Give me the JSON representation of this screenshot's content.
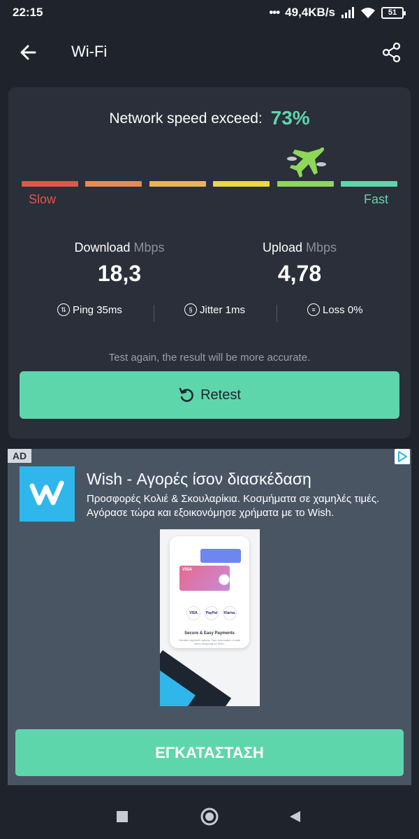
{
  "status_bar": {
    "time": "22:15",
    "net_speed": "49,4KB/s",
    "battery": "51"
  },
  "app_bar": {
    "title": "Wi-Fi",
    "back_icon": "arrow-left-icon",
    "share_icon": "share-icon"
  },
  "result": {
    "exceed_label": "Network speed exceed:",
    "exceed_value": "73%",
    "scale_segment_colors": [
      "#e2554a",
      "#e98a52",
      "#ebb54f",
      "#ecd945",
      "#8fd65a",
      "#5ed6ac"
    ],
    "scale_current_segment": 5,
    "slow_label": "Slow",
    "fast_label": "Fast",
    "download": {
      "label": "Download",
      "unit": "Mbps",
      "value": "18,3"
    },
    "upload": {
      "label": "Upload",
      "unit": "Mbps",
      "value": "4,78"
    },
    "ping": "Ping 35ms",
    "jitter": "Jitter 1ms",
    "loss": "Loss 0%",
    "hint": "Test again, the result will be more accurate.",
    "retest_label": "Retest"
  },
  "ad": {
    "badge": "AD",
    "headline": "Wish - Αγορές ίσον διασκέδαση",
    "body": "Προσφορές Κολιέ & Σκουλαρίκια. Κοσμήματα σε χαμηλές τιμές. Αγόρασε τώρα και εξοικονόμησε χρήματα με το Wish.",
    "image_card_label": "VISA",
    "image_pay_logos": [
      "VISA",
      "PayPal",
      "Klarna."
    ],
    "image_title": "Secure & Easy Payments",
    "image_subtitle": "Familiar payment options. Your information is safe when shopping on Wish.",
    "install_label": "ΕΓΚΑΤΑΣΤΑΣΗ"
  },
  "colors": {
    "accent": "#5ed6ac",
    "background": "#1f242c",
    "card": "#2a2f39",
    "ad_background": "#4a5564",
    "wish_blue": "#2fb7ec"
  }
}
